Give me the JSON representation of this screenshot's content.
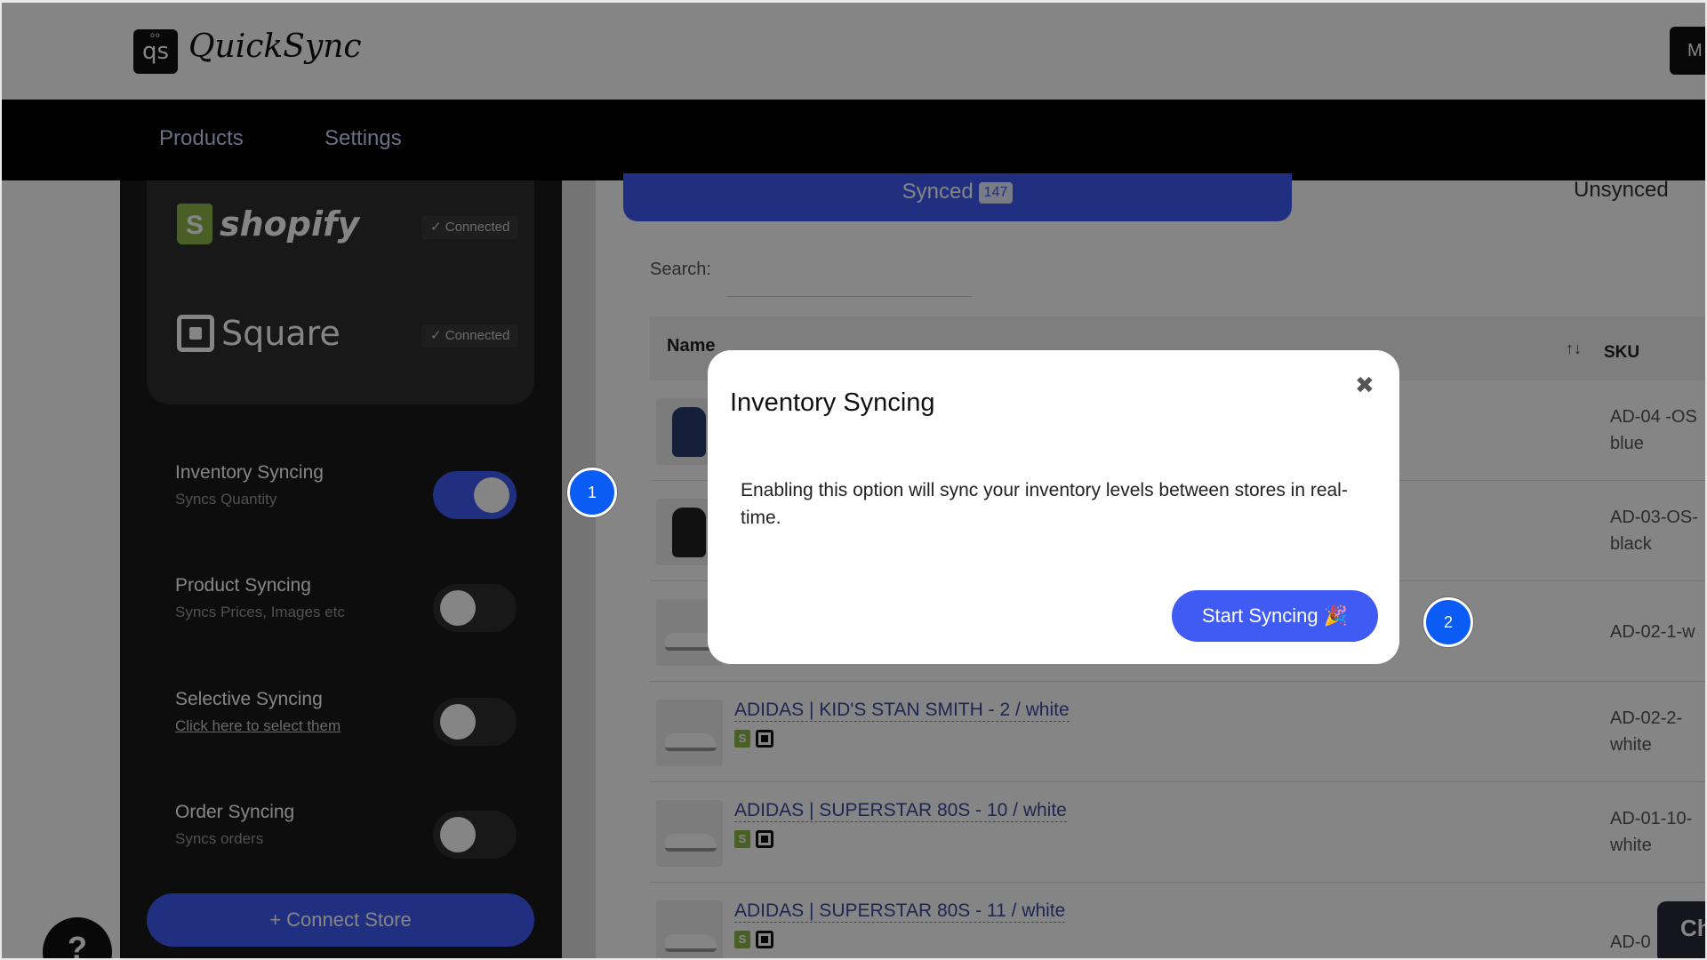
{
  "app": {
    "logo_mark": "qs",
    "logo_text": "QuickSync",
    "user_initial": "M"
  },
  "nav": {
    "items": [
      "Products",
      "Settings"
    ]
  },
  "stores": [
    {
      "name": "shopify",
      "status": "✓ Connected"
    },
    {
      "name": "Square",
      "status": "✓ Connected"
    }
  ],
  "settings": [
    {
      "title": "Inventory Syncing",
      "subtitle": "Syncs Quantity",
      "enabled": true
    },
    {
      "title": "Product Syncing",
      "subtitle": "Syncs Prices, Images etc",
      "enabled": false
    },
    {
      "title": "Selective Syncing",
      "subtitle": "Click here to select them",
      "enabled": false
    },
    {
      "title": "Order Syncing",
      "subtitle": "Syncs orders",
      "enabled": false
    }
  ],
  "connect_store": "+  Connect Store",
  "help": "?",
  "tabs": {
    "synced_label": "Synced",
    "synced_count": "147",
    "unsynced_label": "Unsynced"
  },
  "search": {
    "label": "Search:",
    "value": ""
  },
  "table": {
    "headers": {
      "name": "Name",
      "sort": "↑↓",
      "sku": "SKU"
    },
    "rows": [
      {
        "name": "",
        "sku": "AD-04 -OS blue",
        "thumb_color": "#2a3d6e"
      },
      {
        "name": "",
        "sku": "AD-03-OS-black",
        "thumb_color": "#222222"
      },
      {
        "name": "",
        "sku": "AD-02-1-w",
        "thumb_color": "#f4f4f4"
      },
      {
        "name": "ADIDAS | KID'S STAN SMITH - 2 / white",
        "sku": "AD-02-2-white",
        "thumb_color": "#f4f4f4"
      },
      {
        "name": "ADIDAS | SUPERSTAR 80S - 10 / white",
        "sku": "AD-01-10-white",
        "thumb_color": "#f4f4f4"
      },
      {
        "name": "ADIDAS | SUPERSTAR 80S - 11 / white",
        "sku": "AD-0",
        "thumb_color": "#f4f4f4"
      }
    ]
  },
  "chat": "Ch",
  "modal": {
    "title": "Inventory Syncing",
    "close": "✖",
    "body": "Enabling this option will sync your inventory levels between stores in real-time.",
    "button": "Start Syncing 🎉"
  },
  "steps": [
    "1",
    "2"
  ],
  "colors": {
    "accent": "#3f5bf4",
    "step": "#0a5cf5",
    "shopify_green": "#8db749"
  }
}
